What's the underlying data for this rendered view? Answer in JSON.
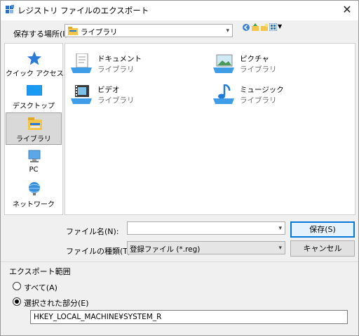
{
  "window": {
    "title": "レジストリ ファイルのエクスポート",
    "close_glyph": "✕"
  },
  "location": {
    "label": "保存する場所(I):",
    "value": "ライブラリ",
    "toolbar_icons": [
      "back-icon",
      "up-folder-icon",
      "new-folder-icon",
      "view-menu-icon"
    ]
  },
  "places": [
    {
      "label": "クイック アクセス",
      "icon": "star-icon",
      "selected": false
    },
    {
      "label": "デスクトップ",
      "icon": "desktop-icon",
      "selected": false
    },
    {
      "label": "ライブラリ",
      "icon": "library-icon",
      "selected": true
    },
    {
      "label": "PC",
      "icon": "pc-icon",
      "selected": false
    },
    {
      "label": "ネットワーク",
      "icon": "network-icon",
      "selected": false
    }
  ],
  "libraries": [
    {
      "name": "ドキュメント",
      "type": "ライブラリ",
      "icon": "documents-icon"
    },
    {
      "name": "ピクチャ",
      "type": "ライブラリ",
      "icon": "pictures-icon"
    },
    {
      "name": "ビデオ",
      "type": "ライブラリ",
      "icon": "videos-icon"
    },
    {
      "name": "ミュージック",
      "type": "ライブラリ",
      "icon": "music-icon"
    }
  ],
  "filename": {
    "label": "ファイル名(N):",
    "value": ""
  },
  "filetype": {
    "label": "ファイルの種類(T):",
    "value": "登録ファイル (*.reg)"
  },
  "buttons": {
    "save": "保存(S)",
    "cancel": "キャンセル"
  },
  "export_range": {
    "title": "エクスポート範囲",
    "all_label": "すべて(A)",
    "selected_label": "選択された部分(E)",
    "selected_checked": true,
    "branch_value": "HKEY_LOCAL_MACHINE¥SYSTEM_R"
  },
  "colors": {
    "accent": "#0078d7",
    "library_folder": "#f3c54a"
  }
}
